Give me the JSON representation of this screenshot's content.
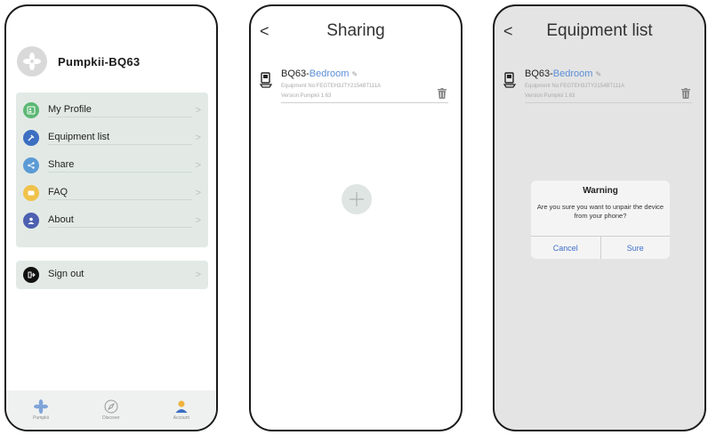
{
  "screen1": {
    "username": "Pumpkii-BQ63",
    "menu": [
      {
        "label": "My Profile",
        "icon": "profile-icon",
        "color": "#5cb874"
      },
      {
        "label": "Equipment list",
        "icon": "equipment-icon",
        "color": "#3c6fc2"
      },
      {
        "label": "Share",
        "icon": "share-icon",
        "color": "#5b9bd5"
      },
      {
        "label": "FAQ",
        "icon": "faq-icon",
        "color": "#f0c24a"
      },
      {
        "label": "About",
        "icon": "about-icon",
        "color": "#4c5fb0"
      }
    ],
    "signout": {
      "label": "Sign out",
      "icon": "signout-icon"
    },
    "chevron": ">",
    "tabs": [
      {
        "label": "Pumpkii",
        "icon": "pumpkii-tab-icon"
      },
      {
        "label": "Discover",
        "icon": "compass-icon"
      },
      {
        "label": "Account",
        "icon": "account-icon"
      }
    ]
  },
  "screen2": {
    "back": "<",
    "title": "Sharing",
    "device": {
      "model": "BQ63-",
      "location": "Bedroom",
      "equipment_no": "Equipment No:FEGTEH3JTY2154BT111A",
      "version": "Version:Pumpkii 1.63"
    }
  },
  "screen3": {
    "back": "<",
    "title": "Equipment list",
    "device": {
      "model": "BQ63-",
      "location": "Bedroom",
      "equipment_no": "Equipment No:FEGTEH3JTY2154BT111A",
      "version": "Version:Pumpkii 1.63"
    },
    "dialog": {
      "title": "Warning",
      "message": "Are you sure you want to unpair the device from your phone?",
      "cancel": "Cancel",
      "confirm": "Sure"
    }
  },
  "colors": {
    "accent_blue": "#5b8fd6",
    "menu_card": "#e3eae6",
    "dialog_button": "#3f6fc8"
  }
}
